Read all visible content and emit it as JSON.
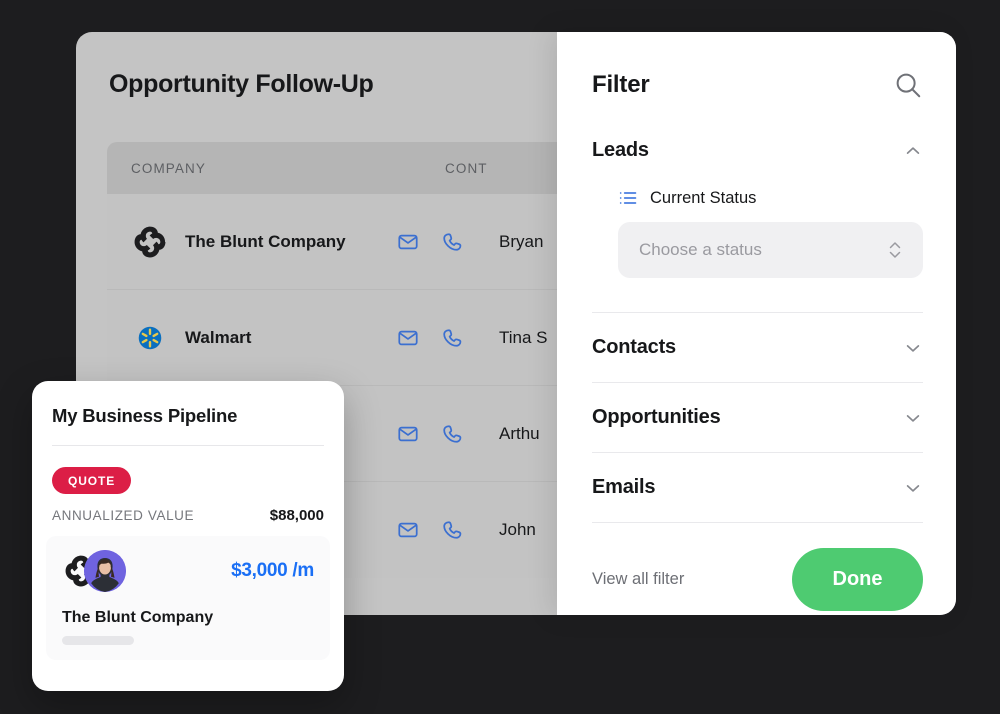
{
  "theme": {
    "backdrop": "#1d1d1f",
    "panel_gray": "#c4c4c4",
    "accent_green": "#4ECB71",
    "accent_red": "#DC1E46",
    "accent_blue": "#1a6ff5",
    "icon_blue": "#3b6fd0",
    "avatar_purple": "#6f63e0"
  },
  "app": {
    "title": "Opportunity Follow-Up",
    "table": {
      "columns": [
        "COMPANY",
        "CONT"
      ],
      "rows": [
        {
          "company": "The Blunt Company",
          "logo": "blunt-pinwheel-logo",
          "contact": "Bryan",
          "mail_icon": "mail-icon",
          "phone_icon": "phone-icon"
        },
        {
          "company": "Walmart",
          "logo": "walmart-spark-logo",
          "contact": "Tina S",
          "mail_icon": "mail-icon",
          "phone_icon": "phone-icon"
        },
        {
          "company": "",
          "logo": "",
          "contact": "Arthu",
          "mail_icon": "mail-icon",
          "phone_icon": "phone-icon"
        },
        {
          "company": "",
          "logo": "",
          "contact": "John",
          "mail_icon": "mail-icon",
          "phone_icon": "phone-icon"
        }
      ]
    }
  },
  "filter": {
    "title": "Filter",
    "search_icon": "search-icon",
    "sections": [
      {
        "label": "Leads",
        "expanded": true,
        "chevron": "chevron-up-icon"
      },
      {
        "label": "Contacts",
        "expanded": false,
        "chevron": "chevron-down-icon"
      },
      {
        "label": "Opportunities",
        "expanded": false,
        "chevron": "chevron-down-icon"
      },
      {
        "label": "Emails",
        "expanded": false,
        "chevron": "chevron-down-icon"
      }
    ],
    "leads": {
      "field_icon": "list-icon",
      "field_label": "Current Status",
      "select_placeholder": "Choose a status",
      "select_value": "",
      "select_icon": "chevron-up-down-icon"
    },
    "footer": {
      "view_all_label": "View all filter",
      "done_label": "Done"
    }
  },
  "pipeline": {
    "title": "My Business Pipeline",
    "badge": "QUOTE",
    "value_label": "ANNUALIZED VALUE",
    "value_amount": "$88,000",
    "item": {
      "logo": "blunt-pinwheel-logo",
      "avatar": "contact-avatar",
      "mrr": "$3,000 /m",
      "company": "The Blunt Company"
    }
  }
}
